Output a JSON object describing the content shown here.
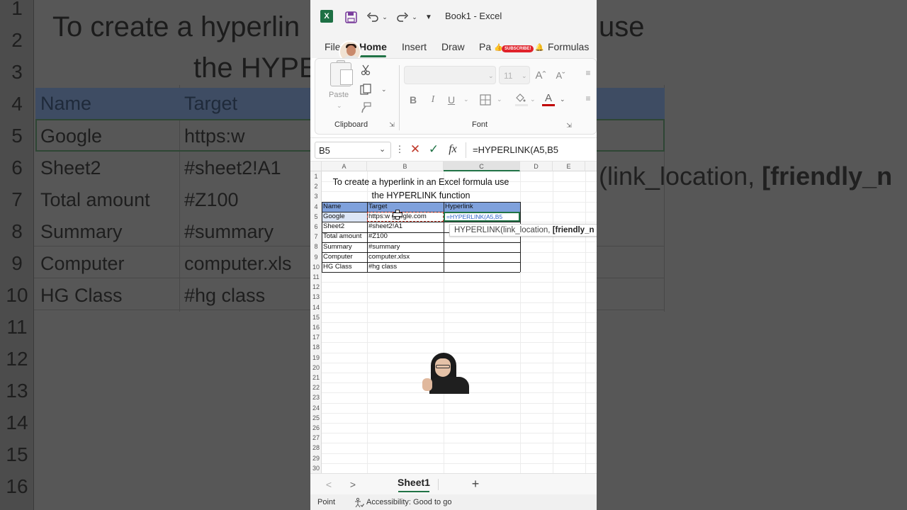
{
  "background": {
    "title_line1": "To create a hyperlin",
    "title_line2": "the HYPE",
    "title_use": "use",
    "row_numbers": [
      "1",
      "2",
      "3",
      "4",
      "5",
      "6",
      "7",
      "8",
      "9",
      "10",
      "11",
      "12",
      "13",
      "14",
      "15",
      "16"
    ],
    "header_name": "Name",
    "header_target": "Target",
    "rows": [
      {
        "name": "Google",
        "target": "https:w"
      },
      {
        "name": "Sheet2",
        "target": "#sheet2!A1"
      },
      {
        "name": "Total amount",
        "target": "#Z100"
      },
      {
        "name": "Summary",
        "target": "#summary"
      },
      {
        "name": "Computer",
        "target": "computer.xls"
      },
      {
        "name": "HG Class",
        "target": "#hg class"
      }
    ],
    "tip_text": "(link_location, ",
    "tip_bold": "[friendly_n"
  },
  "titlebar": {
    "logo_letter": "X",
    "book_title": "Book1  -  Excel"
  },
  "tabs": {
    "file": "File",
    "home": "Home",
    "insert": "Insert",
    "draw": "Draw",
    "page": "Pa",
    "formulas": "Formulas"
  },
  "overlay": {
    "subscribe": "SUBSCRIBE!"
  },
  "ribbon": {
    "paste": "Paste",
    "clipboard": "Clipboard",
    "font": "Font",
    "font_size": "11"
  },
  "formula_bar": {
    "name_box": "B5",
    "fx": "fx",
    "formula": "=HYPERLINK(A5,B5"
  },
  "grid": {
    "columns": [
      "A",
      "B",
      "C",
      "D",
      "E"
    ],
    "rows": [
      "1",
      "2",
      "3",
      "4",
      "5",
      "6",
      "7",
      "8",
      "9",
      "10",
      "11",
      "12",
      "13",
      "14",
      "15",
      "16",
      "17",
      "18",
      "19",
      "20",
      "21",
      "22",
      "23",
      "24",
      "25",
      "26",
      "27",
      "28",
      "29",
      "30"
    ],
    "title_line1": "To create a hyperlink in an Excel formula use",
    "title_line2": "the HYPERLINK function",
    "headers": [
      "Name",
      "Target",
      "Hyperlink"
    ],
    "data": [
      {
        "name": "Google",
        "target": "https:w   google.com",
        "hyperlink": "=HYPERLINK(A5,B5"
      },
      {
        "name": "Sheet2",
        "target": "#sheet2!A1",
        "hyperlink": ""
      },
      {
        "name": "Total amount",
        "target": "#Z100",
        "hyperlink": ""
      },
      {
        "name": "Summary",
        "target": "#summary",
        "hyperlink": ""
      },
      {
        "name": "Computer",
        "target": "computer.xlsx",
        "hyperlink": ""
      },
      {
        "name": "HG Class",
        "target": "#hg class",
        "hyperlink": ""
      }
    ],
    "tooltip_normal": "HYPERLINK(link_location, ",
    "tooltip_bold": "[friendly_n"
  },
  "sheets": {
    "active": "Sheet1",
    "prev": "<",
    "next": ">",
    "add": "+"
  },
  "status": {
    "mode": "Point",
    "accessibility": "Accessibility: Good to go"
  },
  "colors": {
    "excel_green": "#217346",
    "table_header": "#7fa1dc",
    "selection_dash": "#c0392b",
    "formula_ref": "#2b62c9"
  }
}
